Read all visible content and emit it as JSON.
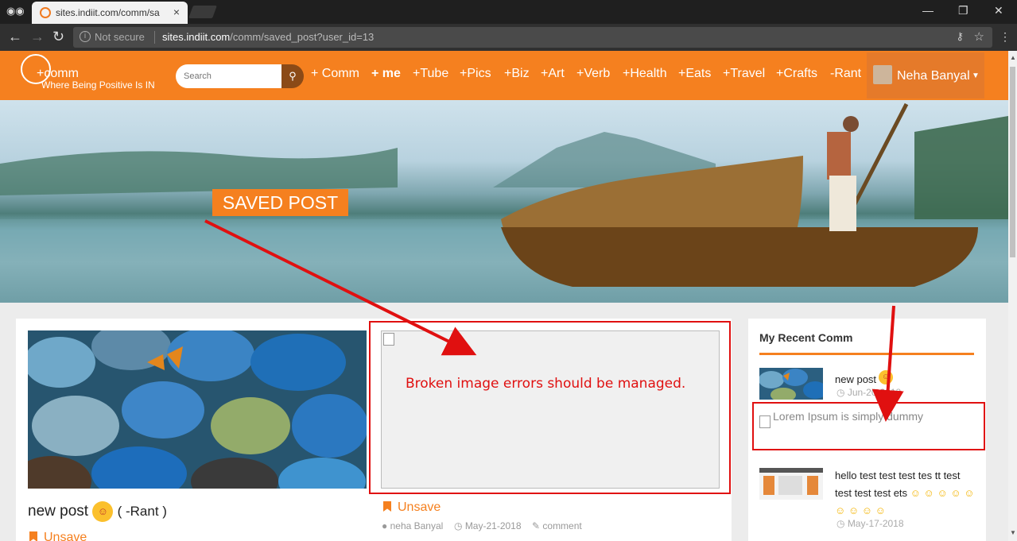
{
  "browser": {
    "tab_title": "sites.indiit.com/comm/sa",
    "tab_close": "×",
    "security_label": "Not secure",
    "url_host": "sites.indiit.com",
    "url_path": "/comm/saved_post?user_id=13"
  },
  "site": {
    "logo_text": "+comm",
    "tagline": "Where Being Positive Is IN",
    "search_placeholder": "Search",
    "nav": [
      "+ Comm",
      "+ me",
      "+Tube",
      "+Pics",
      "+Biz",
      "+Art",
      "+Verb",
      "+Health",
      "+Eats",
      "+Travel",
      "+Crafts",
      "-Rant"
    ],
    "user_name": "Neha Banyal"
  },
  "banner": {
    "badge": "SAVED POST"
  },
  "posts": [
    {
      "title": "new post",
      "category": "( -Rant )",
      "unsave_label": "Unsave"
    },
    {
      "unsave_label": "Unsave",
      "author": "neha Banyal",
      "date": "May-21-2018",
      "comment_label": "comment"
    }
  ],
  "sidebar": {
    "title": "My Recent Comm",
    "items": [
      {
        "text": "new post",
        "date": "Jun-20-2018"
      },
      {
        "text": "Lorem Ipsum is simply dummy"
      },
      {
        "text": "hello test test test tes tt test test test test ets",
        "date": "May-17-2018"
      }
    ]
  },
  "annotation": {
    "message": "Broken image errors should be managed.",
    "color": "#e01010"
  },
  "colors": {
    "brand": "#f5801f",
    "chrome": "#303030"
  }
}
